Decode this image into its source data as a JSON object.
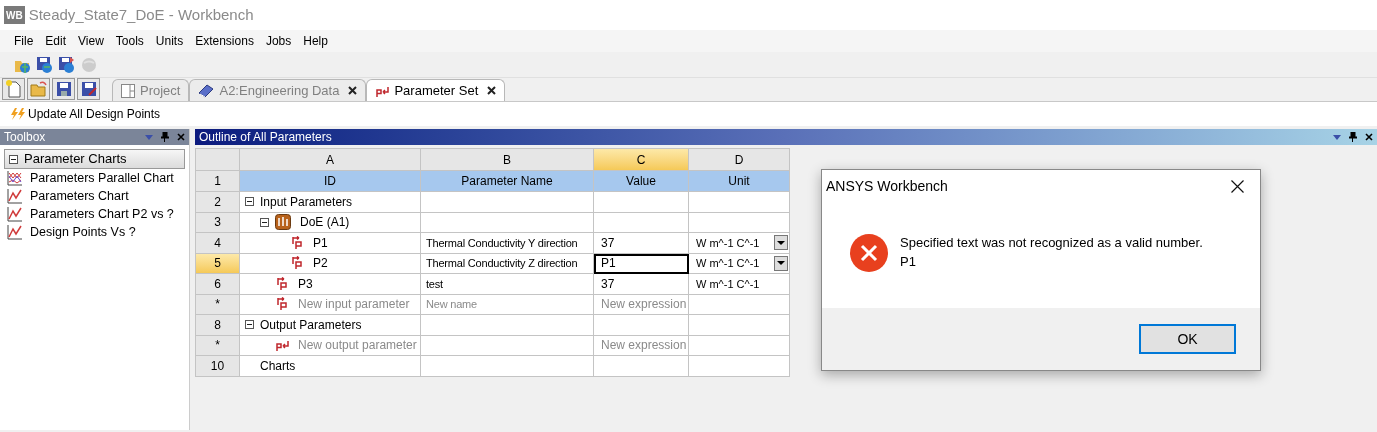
{
  "window": {
    "logo": "WB",
    "title": "Steady_State7_DoE - Workbench"
  },
  "menu": [
    "File",
    "Edit",
    "View",
    "Tools",
    "Units",
    "Extensions",
    "Jobs",
    "Help"
  ],
  "toolbar_top": [
    {
      "kind": "open-web",
      "disabled": false
    },
    {
      "kind": "save-web",
      "disabled": false
    },
    {
      "kind": "saveas-web",
      "disabled": false
    },
    {
      "kind": "globe",
      "disabled": true
    }
  ],
  "toolbar_file": [
    {
      "kind": "new"
    },
    {
      "kind": "open"
    },
    {
      "kind": "save"
    },
    {
      "kind": "saveas"
    }
  ],
  "tabs": [
    {
      "label": "Project",
      "kind": "project",
      "selected": false,
      "closable": false
    },
    {
      "label": "A2:Engineering Data",
      "kind": "book",
      "selected": false,
      "closable": true
    },
    {
      "label": "Parameter Set",
      "kind": "parameters",
      "selected": true,
      "closable": true
    }
  ],
  "update_button": "Update All Design Points",
  "toolbox": {
    "title": "Toolbox",
    "group": {
      "label": "Parameter Charts",
      "expanded": true,
      "items": [
        {
          "label": "Parameters Parallel Chart",
          "kind": "parallel"
        },
        {
          "label": "Parameters Chart",
          "kind": "line"
        },
        {
          "label": "Parameters Chart P2 vs ?",
          "kind": "line"
        },
        {
          "label": "Design Points Vs  ?",
          "kind": "line"
        }
      ]
    }
  },
  "outline": {
    "title": "Outline of All Parameters",
    "columns": [
      {
        "letter": "A",
        "selected": false
      },
      {
        "letter": "B",
        "selected": false
      },
      {
        "letter": "C",
        "selected": true
      },
      {
        "letter": "D",
        "selected": false
      }
    ],
    "header_row": {
      "num": "1",
      "cells": [
        "ID",
        "Parameter Name",
        "Value",
        "Unit"
      ]
    },
    "rows": [
      {
        "num": "2",
        "kind": "group",
        "id": "Input Parameters",
        "expanded": true,
        "selected": false,
        "children": [
          {
            "num": "3",
            "kind": "system",
            "id": "DoE (A1)",
            "expanded": true,
            "selected": false,
            "children": [
              {
                "num": "4",
                "kind": "parameter",
                "id": "P1",
                "name": "Thermal Conductivity Y direction",
                "value": "37",
                "unit": "W m^-1 C^-1",
                "dropdown": true,
                "editing": false,
                "selected": false
              },
              {
                "num": "5",
                "kind": "parameter",
                "id": "P2",
                "name": "Thermal Conductivity Z direction",
                "value": "P1",
                "unit": "W m^-1 C^-1",
                "dropdown": true,
                "editing": true,
                "selected": true
              }
            ]
          },
          {
            "num": "6",
            "kind": "parameter",
            "id": "P3",
            "name": "test",
            "value": "37",
            "unit": "W m^-1 C^-1",
            "dropdown": false,
            "editing": false,
            "selected": false
          },
          {
            "num": "*",
            "kind": "new_input",
            "id": "New input parameter",
            "name": "New name",
            "value": "New expression",
            "selected": false
          }
        ]
      },
      {
        "num": "8",
        "kind": "group",
        "id": "Output Parameters",
        "expanded": true,
        "selected": false,
        "children": [
          {
            "num": "*",
            "kind": "new_output",
            "id": "New output parameter",
            "value": "New expression",
            "selected": false
          }
        ]
      },
      {
        "num": "10",
        "kind": "item",
        "id": "Charts",
        "selected": false
      }
    ]
  },
  "dialog": {
    "title": "ANSYS Workbench",
    "message": [
      "Specified text was not recognized as a valid number.",
      "P1"
    ],
    "button": "OK"
  }
}
